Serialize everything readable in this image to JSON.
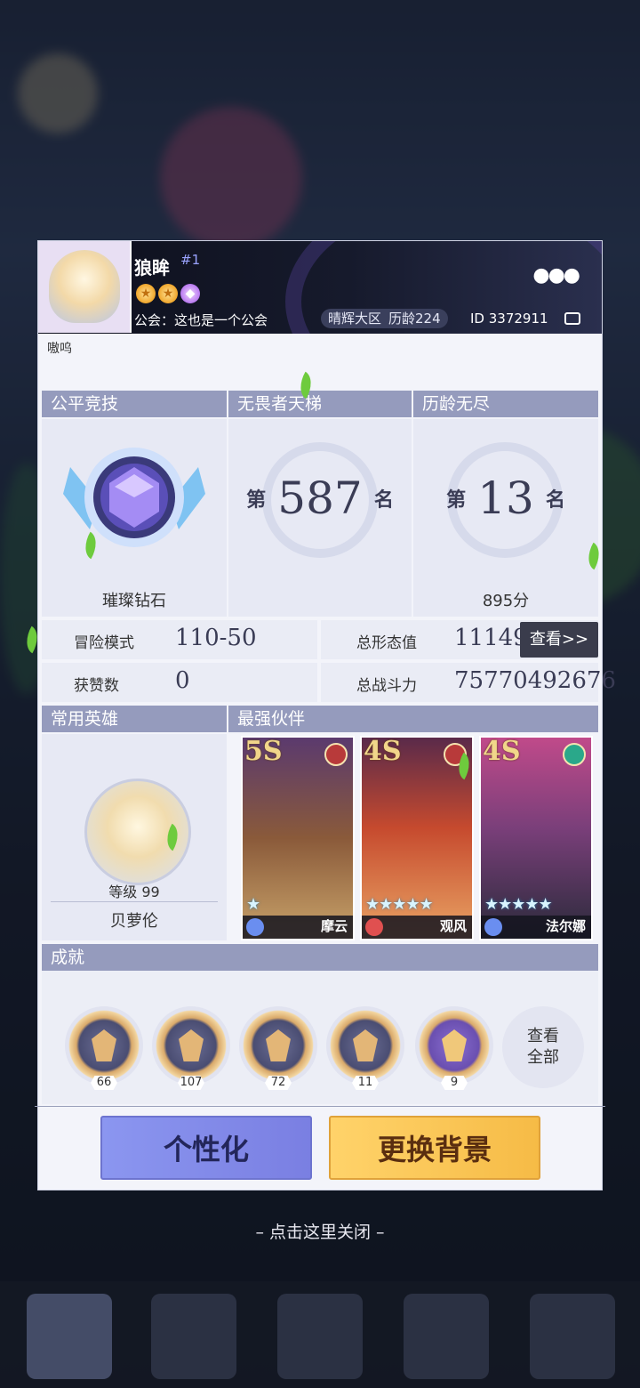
{
  "profile": {
    "name": "狼眸",
    "rank_tag": "#1",
    "guild": "公会：这也是一个公会",
    "server": "晴辉大区",
    "age": "历龄224",
    "player_id": "ID 3372911",
    "signature": "嗷呜",
    "more_icon": "more-dots-icon"
  },
  "modes": {
    "fair": {
      "title": "公平竞技",
      "tier": "璀璨钻石"
    },
    "ladder": {
      "title": "无畏者天梯",
      "prefix": "第",
      "rank": "587",
      "suffix": "名"
    },
    "endless": {
      "title": "历龄无尽",
      "prefix": "第",
      "rank": "13",
      "suffix": "名",
      "score": "895分"
    }
  },
  "stats": {
    "adventure_label": "冒险模式",
    "adventure_value": "110-50",
    "likes_label": "获赞数",
    "likes_value": "0",
    "form_label": "总形态值",
    "form_value": "111496",
    "power_label": "总战斗力",
    "power_value": "75770492676",
    "view_button": "查看>>"
  },
  "hero": {
    "section_title": "常用英雄",
    "level": "等级 99",
    "name": "贝萝伦"
  },
  "partners": {
    "section_title": "最强伙伴",
    "cards": [
      {
        "grade": "5S",
        "name": "摩云",
        "stars": "★",
        "color": "#7a4a2a"
      },
      {
        "grade": "4S",
        "name": "观风",
        "stars": "★★★★★",
        "color": "#b8402c"
      },
      {
        "grade": "4S",
        "name": "法尔娜",
        "stars": "★★★★★",
        "color": "#7a3f7a"
      }
    ]
  },
  "achievements": {
    "section_title": "成就",
    "items": [
      "66",
      "107",
      "72",
      "11",
      "9"
    ],
    "view_all_line1": "查看",
    "view_all_line2": "全部"
  },
  "buttons": {
    "customize": "个性化",
    "change_bg": "更换背景"
  },
  "close_hint": "– 点击这里关闭 –",
  "colors": {
    "header_dark": "#0d0f1c",
    "section_head": "#959bbd",
    "gold": "#f6bb46",
    "periwinkle": "#8b96f0"
  }
}
